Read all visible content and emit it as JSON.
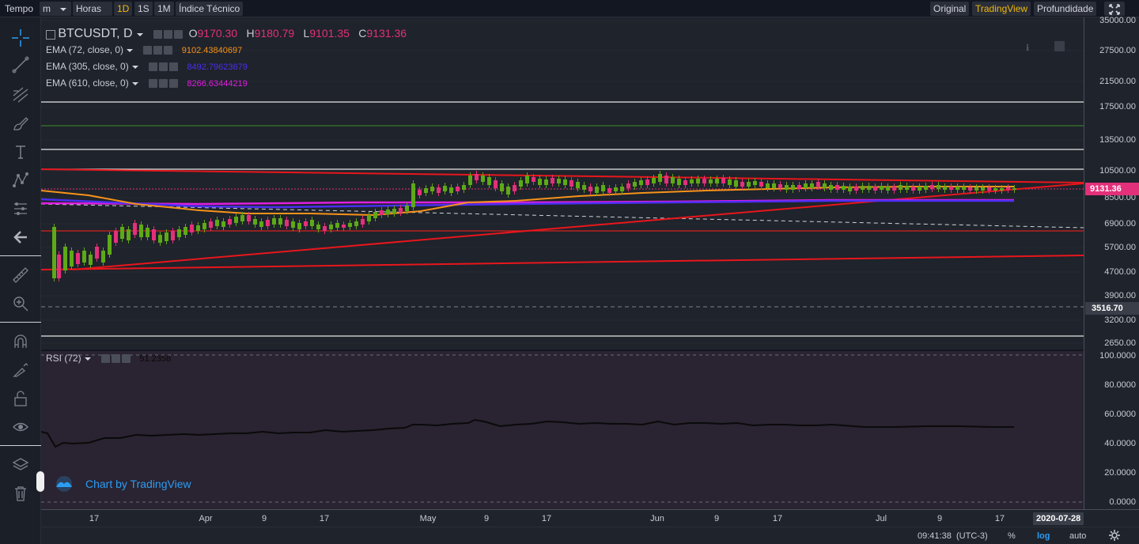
{
  "toolbar": {
    "tempo": "Tempo",
    "minutes": "m",
    "hours": "Horas",
    "interval_1d": "1D",
    "interval_1s": "1S",
    "interval_1m": "1M",
    "indicators": "Índice Técnico",
    "view_original": "Original",
    "view_tradingview": "TradingView",
    "view_depth": "Profundidade"
  },
  "legend": {
    "symbol": "BTCUSDT, D",
    "open_label": "O",
    "open": "9170.30",
    "high_label": "H",
    "high": "9180.79",
    "low_label": "L",
    "low": "9101.35",
    "close_label": "C",
    "close": "9131.36",
    "indicators": [
      {
        "name": "EMA (72, close, 0)",
        "value": "9102.43840697",
        "color": "#f7931a"
      },
      {
        "name": "EMA (305, close, 0)",
        "value": "8492.79623679",
        "color": "#4b2ff0"
      },
      {
        "name": "EMA (610, close, 0)",
        "value": "8266.63444219",
        "color": "#e01ee0"
      }
    ]
  },
  "rsi": {
    "name": "RSI (72)",
    "value": "51.2358"
  },
  "price_scale": {
    "labels": [
      "35000.00",
      "27500.00",
      "21500.00",
      "17500.00",
      "13500.00",
      "10500.00",
      "8500.00",
      "6900.00",
      "5700.00",
      "4700.00",
      "3900.00",
      "3200.00",
      "2650.00"
    ],
    "last_price": "9131.36",
    "marker_price": "3516.70"
  },
  "rsi_scale": {
    "labels": [
      "100.0000",
      "80.0000",
      "60.0000",
      "40.0000",
      "20.0000",
      "0.0000"
    ]
  },
  "time_axis": {
    "labels": [
      "17",
      "Apr",
      "9",
      "17",
      "May",
      "9",
      "17",
      "Jun",
      "9",
      "17",
      "Jul",
      "9",
      "17"
    ],
    "cursor_date": "2020-07-28"
  },
  "watermark": "Chart by TradingView",
  "status": {
    "time": "09:41:38",
    "tz": "(UTC-3)",
    "percent": "%",
    "log": "log",
    "auto": "auto"
  },
  "colors": {
    "up": "#5ea917",
    "down": "#e3307a",
    "accent": "#f0b90b",
    "blue": "#2a9df4"
  },
  "icons": [
    "crosshair-icon",
    "trendline-icon",
    "fib-icon",
    "brush-icon",
    "text-icon",
    "pattern-icon",
    "prediction-icon",
    "back-arrow-icon",
    "ruler-icon",
    "zoom-icon",
    "magnet-icon",
    "lock-draw-icon",
    "unlock-icon",
    "eye-icon",
    "layers-icon",
    "trash-icon"
  ]
}
